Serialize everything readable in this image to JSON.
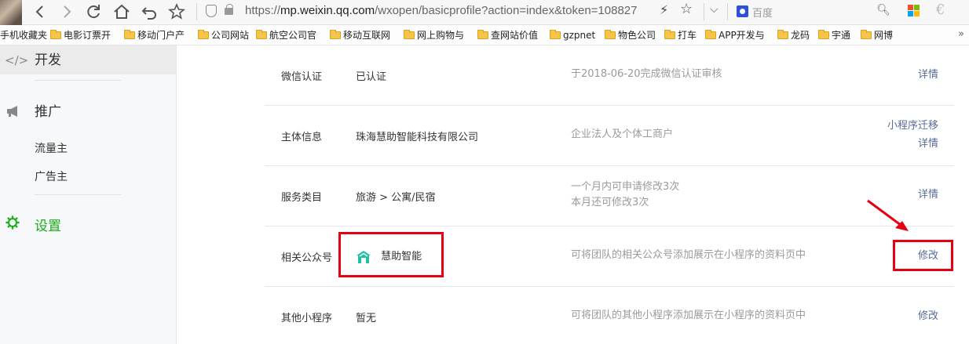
{
  "browser": {
    "url_prefix": "https://",
    "url_host": "mp.weixin.qq.com",
    "url_path": "/wxopen/basicprofile?action=index&token=108827",
    "search_placeholder": "百度"
  },
  "bookmarks": [
    "手机收藏夹",
    "电影订票开",
    "移动门户产",
    "公司网站",
    "航空公司官",
    "移动互联网",
    "网上购物与",
    "查网站价值",
    "gzpnet",
    "物色公司",
    "打车",
    "APP开发与",
    "龙码",
    "宇通",
    "网博"
  ],
  "sidebar": {
    "dev_label": "开发",
    "promote_label": "推广",
    "traffic_owner": "流量主",
    "advertiser": "广告主",
    "settings_label": "设置"
  },
  "rows": [
    {
      "label": "微信认证",
      "value": "已认证",
      "desc": [
        "于2018-06-20完成微信认证审核"
      ],
      "actions": [
        "详情"
      ]
    },
    {
      "label": "主体信息",
      "value": "珠海慧助智能科技有限公司",
      "desc": [
        "企业法人及个体工商户"
      ],
      "actions": [
        "小程序迁移",
        "详情"
      ]
    },
    {
      "label": "服务类目",
      "value": "旅游 > 公寓/民宿",
      "desc": [
        "一个月内可申请修改3次",
        "本月还可修改3次"
      ],
      "actions": [
        "详情"
      ]
    },
    {
      "label": "相关公众号",
      "value": "慧助智能",
      "desc": [
        "可将团队的相关公众号添加展示在小程序的资料页中"
      ],
      "actions": [
        "修改"
      ]
    },
    {
      "label": "其他小程序",
      "value": "暂无",
      "desc": [
        "可将团队的其他小程序添加展示在小程序的资料页中"
      ],
      "actions": [
        "修改"
      ]
    }
  ],
  "colors": {
    "link": "#576b95",
    "highlight": "#e60012",
    "accent_green": "#1aad19",
    "mp_logo": "#1fc1a3"
  }
}
